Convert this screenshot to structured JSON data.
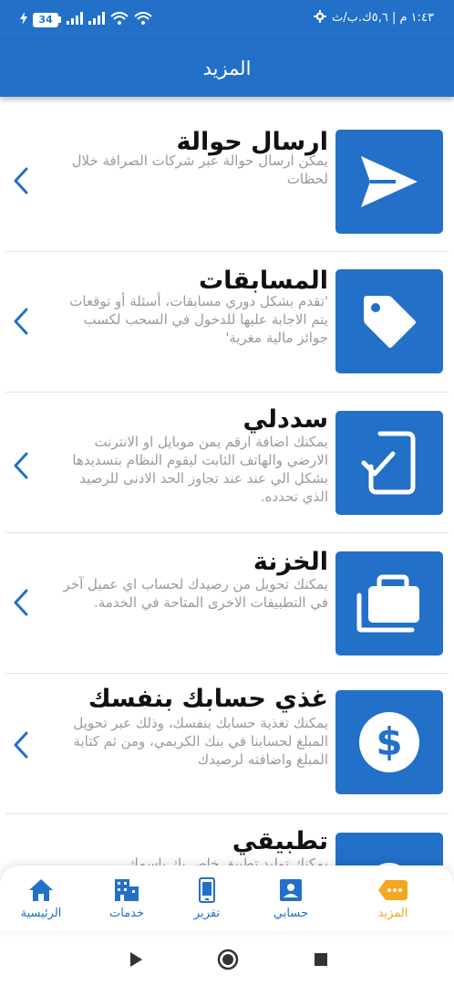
{
  "status_bar": {
    "time": "١:٤٣ م | ٥,٦ك.ب/ث",
    "battery": "34"
  },
  "app_bar": {
    "title": "المزيد"
  },
  "items": [
    {
      "title": "ارسال حوالة",
      "description": "يمكن ارسال حوالة عبر شركات الصرافة خلال لحظات",
      "icon": "send-icon"
    },
    {
      "title": "المسابقات",
      "description": "'تقدم بشكل دوري مسابقات، أسئلة أو توقعات يتم الاجابة عليها للدخول في السحب لكسب جوائز مالية مغرية'",
      "icon": "tag-icon"
    },
    {
      "title": "سددلي",
      "description": "يمكنك اضافة ارقم يمن موبايل او الانترنت الارضي والهاتف الثابت ليقوم النظام بتسديدها بشكل الي عند عند تجاوز الحد الادنى للرصيد الذي تحدده.",
      "icon": "mobile-check-icon"
    },
    {
      "title": "الخزنة",
      "description": "يمكنك تحويل من رصيدك لحساب اي عميل آخر في التطبيقات الاخرى المتاحة في الخدمة.",
      "icon": "briefcase-icon"
    },
    {
      "title": "غذي حسابك بنفسك",
      "description": "يمكنك تغذية حسابك بنفسك، وذلك عبر تحويل المبلغ لحسابنا في بنك الكريمي، ومن ثم كتابة المبلغ واضافته لرصيدك",
      "icon": "dollar-icon"
    },
    {
      "title": "تطبيقي",
      "description": "يمكنك توليد تطبيق خاص بك باسمك",
      "icon": "app-icon"
    }
  ],
  "bottom_nav": [
    {
      "label": "المزيد",
      "icon": "more-icon",
      "active": true
    },
    {
      "label": "حسابي",
      "icon": "account-icon",
      "active": false
    },
    {
      "label": "تقرير",
      "icon": "report-icon",
      "active": false
    },
    {
      "label": "خدمات",
      "icon": "services-icon",
      "active": false
    },
    {
      "label": "الرئيسية",
      "icon": "home-icon",
      "active": false
    }
  ],
  "colors": {
    "primary": "#2270c8",
    "active_nav": "#f5a623",
    "description": "#9a9a9a"
  }
}
